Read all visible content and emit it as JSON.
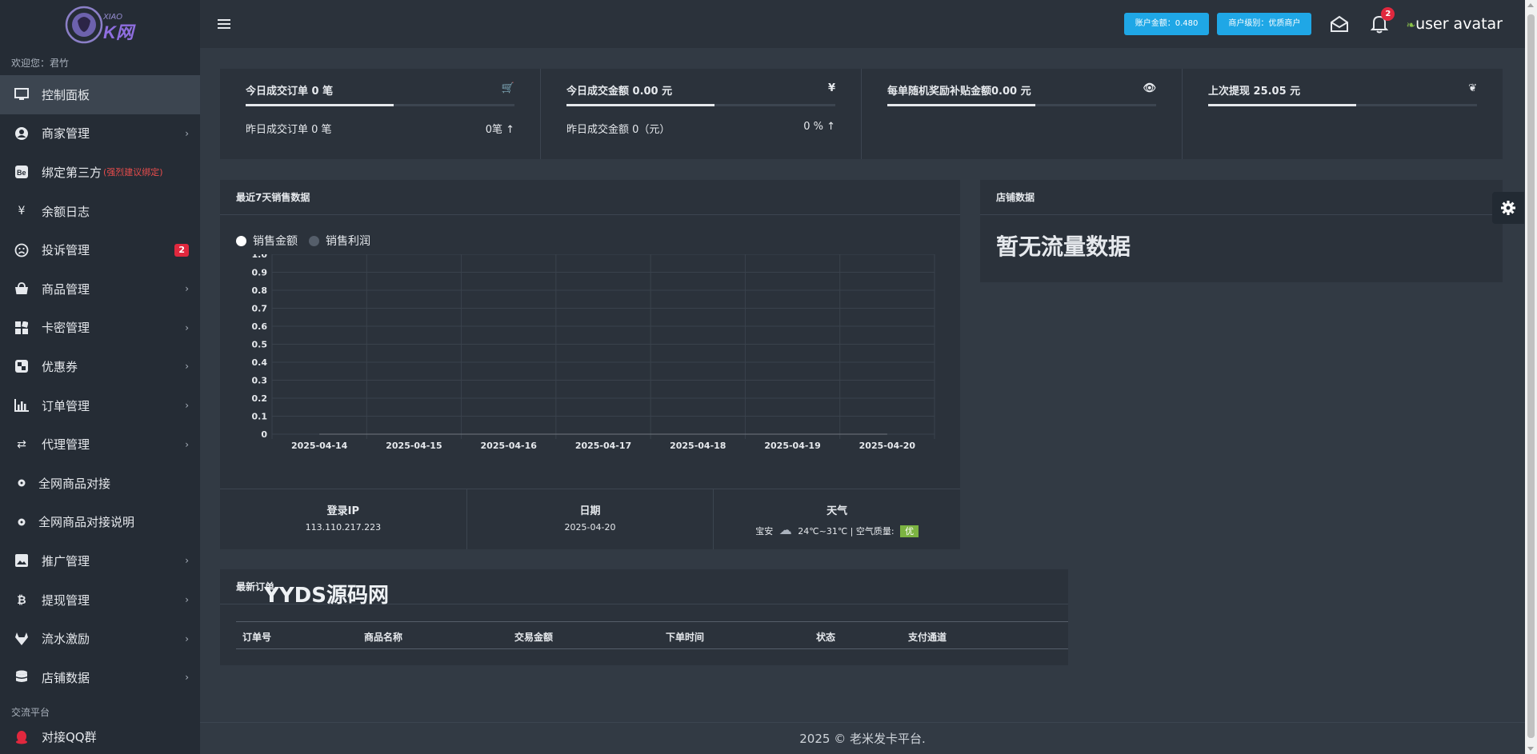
{
  "sidebar": {
    "logo_text": "XIAO K网",
    "welcome": "欢迎您：君竹",
    "items": [
      {
        "label": "控制面板",
        "icon": "monitor-icon",
        "active": true
      },
      {
        "label": "商家管理",
        "icon": "user-circle-icon"
      },
      {
        "label": "绑定第三方",
        "hint": "(强烈建议绑定)",
        "icon": "behance-icon"
      },
      {
        "label": "余额日志",
        "icon": "yen-icon"
      },
      {
        "label": "投诉管理",
        "icon": "frown-icon",
        "badge": "2"
      },
      {
        "label": "商品管理",
        "icon": "shopping-bag-icon"
      },
      {
        "label": "卡密管理",
        "icon": "grid-icon"
      },
      {
        "label": "优惠券",
        "icon": "coupon-icon"
      },
      {
        "label": "订单管理",
        "icon": "bar-chart-icon"
      },
      {
        "label": "代理管理",
        "icon": "exchange-icon"
      },
      {
        "label": "全网商品对接",
        "icon": "dot-circle-icon"
      },
      {
        "label": "全网商品对接说明",
        "icon": "dot-circle-icon"
      },
      {
        "label": "推广管理",
        "icon": "image-icon"
      },
      {
        "label": "提现管理",
        "icon": "bitcoin-icon"
      },
      {
        "label": "流水激励",
        "icon": "gitlab-icon"
      },
      {
        "label": "店铺数据",
        "icon": "database-icon"
      }
    ],
    "section_label": "交流平台",
    "qq_label": "对接QQ群"
  },
  "header": {
    "balance": "账户金额：0.480",
    "merchant_level": "商户级别：优质商户",
    "notification_count": "2",
    "avatar_text": "user avatar"
  },
  "stats": [
    {
      "title": "今日成交订单 0 笔",
      "icon": "cart-icon",
      "icon_char": "🛒",
      "progress": 0.55,
      "sub_left": "昨日成交订单 0 笔",
      "sub_right": "0笔 ↑"
    },
    {
      "title": "今日成交金额 0.00 元",
      "icon": "yen-icon",
      "icon_char": "¥",
      "progress": 0.55,
      "sub_left": "昨日成交金额 0（元）",
      "sub_right": "0 % ↑"
    },
    {
      "title": "每单随机奖励补贴金额0.00 元",
      "icon": "eye-icon",
      "icon_char": "👁",
      "progress": 0.55,
      "sub_left": "",
      "sub_right": ""
    },
    {
      "title": "上次提现 25.05 元",
      "icon": "leaf-icon",
      "icon_char": "❦",
      "progress": 0.55,
      "sub_left": "",
      "sub_right": ""
    }
  ],
  "sales": {
    "title": "最近7天销售数据",
    "legend_amount": "销售金额",
    "legend_profit": "销售利润"
  },
  "chart_data": {
    "type": "line",
    "categories": [
      "2025-04-14",
      "2025-04-15",
      "2025-04-16",
      "2025-04-17",
      "2025-04-18",
      "2025-04-19",
      "2025-04-20"
    ],
    "series": [
      {
        "name": "销售金额",
        "values": [
          0,
          0,
          0,
          0,
          0,
          0,
          0
        ],
        "color": "#ffffff"
      },
      {
        "name": "销售利润",
        "values": [
          0,
          0,
          0,
          0,
          0,
          0,
          0
        ],
        "color": "#555e6a"
      }
    ],
    "ylim": [
      0,
      1
    ],
    "yticks": [
      "0",
      "0.1",
      "0.2",
      "0.3",
      "0.4",
      "0.5",
      "0.6",
      "0.7",
      "0.8",
      "0.9",
      "1.0"
    ],
    "grid": true,
    "legend": "top-left"
  },
  "info": {
    "ip_title": "登录IP",
    "ip_value": "113.110.217.223",
    "date_title": "日期",
    "date_value": "2025-04-20",
    "weather_title": "天气",
    "weather_city": "宝安",
    "weather_temp": "24℃~31℃ | 空气质量:",
    "weather_aq": "优"
  },
  "shop": {
    "title": "店铺数据",
    "nodata": "暂无流量数据"
  },
  "orders": {
    "title": "最新订单",
    "watermark": "YYDS源码网",
    "columns": [
      "订单号",
      "商品名称",
      "交易金额",
      "下单时间",
      "状态",
      "支付通道"
    ]
  },
  "footer": "2025 © 老米发卡平台."
}
